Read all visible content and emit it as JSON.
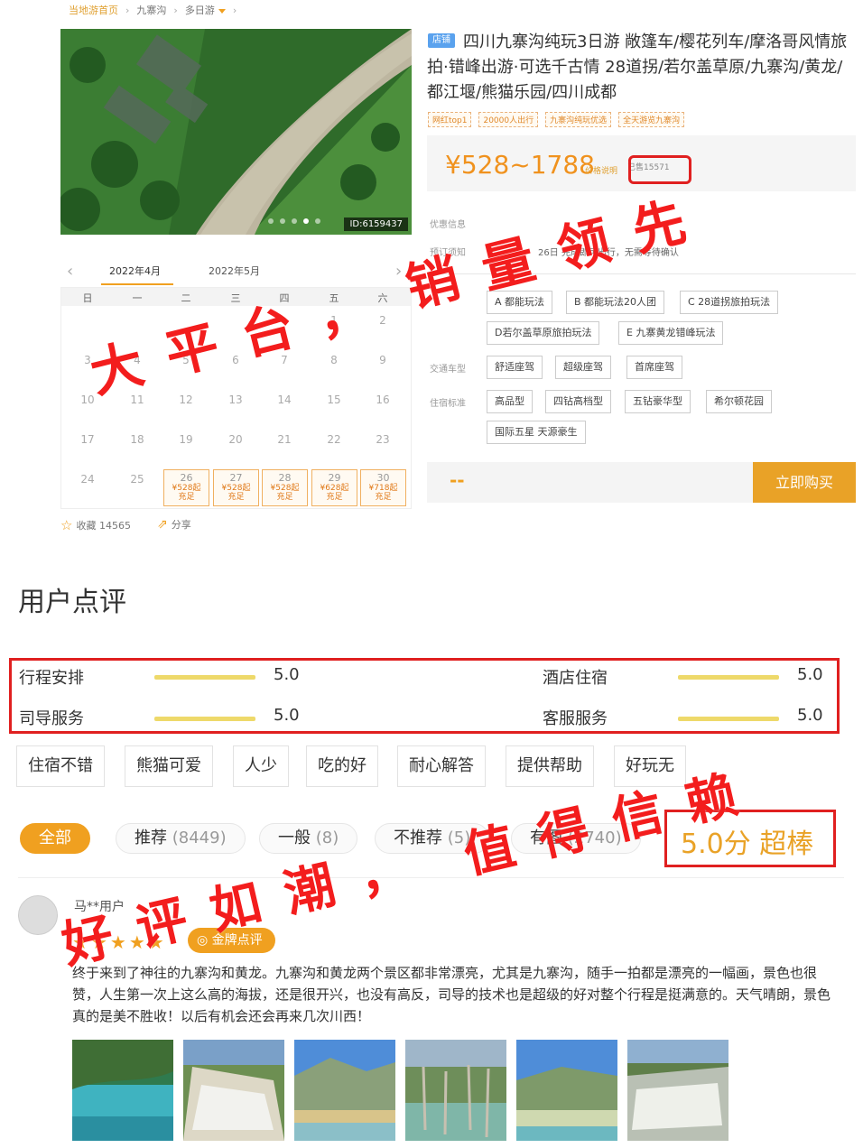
{
  "breadcrumb": {
    "home": "当地游首页",
    "dest": "九寨沟",
    "category": "多日游"
  },
  "hero": {
    "image_id": "ID:6159437",
    "dots": 5,
    "active_dot": 4
  },
  "product": {
    "shop_tag": "店铺",
    "title": "四川九寨沟纯玩3日游 敞篷车/樱花列车/摩洛哥风情旅拍·错峰出游·可选千古情 28道拐/若尔盖草原/九寨沟/黄龙/都江堰/熊猫乐园/四川成都",
    "tags": [
      "网红top1",
      "20000人出行",
      "九寨沟纯玩优选",
      "全天游览九寨沟"
    ],
    "price": "¥528~1788",
    "price_note": "价格说明",
    "sold": "已售15571",
    "discount_label": "优惠信息",
    "booking_label": "预订须知",
    "booking_text": "26日 完成即可出行，无需等待确认",
    "plans": [
      "A 都能玩法",
      "B 都能玩法20人团",
      "C 28道拐旅拍玩法",
      "D若尔盖草原旅拍玩法",
      "E 九寨黄龙错峰玩法"
    ],
    "transport_label": "交通车型",
    "transport": [
      "舒适座驾",
      "超级座驾",
      "首席座驾"
    ],
    "hotel_label": "住宿标准",
    "hotels": [
      "高品型",
      "四钻高档型",
      "五钻豪华型",
      "希尔顿花园",
      "国际五星 天源豪生"
    ],
    "dash": "--",
    "buy": "立即购买"
  },
  "calendar": {
    "prev": "‹",
    "next": "›",
    "months": [
      "2022年4月",
      "2022年5月"
    ],
    "weekdays": [
      "日",
      "一",
      "二",
      "三",
      "四",
      "五",
      "六"
    ],
    "rows": [
      [
        "",
        "",
        "",
        "",
        "",
        "1",
        "2"
      ],
      [
        "3",
        "4",
        "5",
        "6",
        "7",
        "8",
        "9"
      ],
      [
        "10",
        "11",
        "12",
        "13",
        "14",
        "15",
        "16"
      ],
      [
        "17",
        "18",
        "19",
        "20",
        "21",
        "22",
        "23"
      ]
    ],
    "last_plain": [
      "24",
      "25"
    ],
    "price_cells": [
      {
        "day": "26",
        "price": "¥528起",
        "note": "充足"
      },
      {
        "day": "27",
        "price": "¥528起",
        "note": "充足"
      },
      {
        "day": "28",
        "price": "¥528起",
        "note": "充足"
      },
      {
        "day": "29",
        "price": "¥628起",
        "note": "充足"
      },
      {
        "day": "30",
        "price": "¥718起",
        "note": "充足"
      }
    ],
    "favorites": "收藏 14565",
    "share": "分享"
  },
  "reviews": {
    "title": "用户点评",
    "ratings": [
      {
        "label": "行程安排",
        "value": "5.0"
      },
      {
        "label": "酒店住宿",
        "value": "5.0"
      },
      {
        "label": "司导服务",
        "value": "5.0"
      },
      {
        "label": "客服服务",
        "value": "5.0"
      }
    ],
    "keywords": [
      "住宿不错",
      "熊猫可爱",
      "人少",
      "吃的好",
      "耐心解答",
      "提供帮助",
      "好玩无"
    ],
    "filters": [
      {
        "label": "全部",
        "count": ""
      },
      {
        "label": "推荐",
        "count": "(8449)"
      },
      {
        "label": "一般",
        "count": "(8)"
      },
      {
        "label": "不推荐",
        "count": "(5)"
      },
      {
        "label": "有图",
        "count": "(2740)"
      }
    ],
    "score": "5.0分 超棒",
    "user": "马**用户",
    "badge": "金牌点评",
    "comment": "终于来到了神往的九寨沟和黄龙。九寨沟和黄龙两个景区都非常漂亮，尤其是九寨沟，随手一拍都是漂亮的一幅画，景色也很赞，人生第一次上这么高的海拔，还是很开兴，也没有高反，司导的技术也是超级的好对整个行程是挺满意的。天气晴朗，景色真的是美不胜收！以后有机会还会再来几次川西！"
  },
  "overlay": {
    "slogan1": "大平台，",
    "slogan2": "销量领先",
    "slogan3": "好评如潮，",
    "slogan4": "值得信赖"
  }
}
